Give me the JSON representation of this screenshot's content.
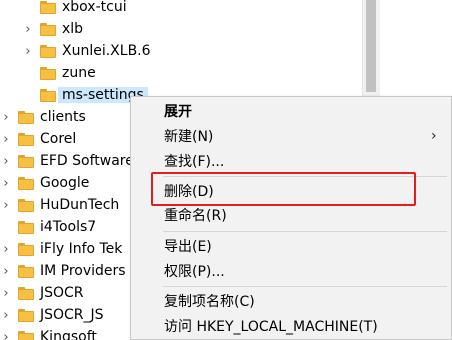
{
  "tree": {
    "child_folders": [
      {
        "label": "xbox-tcui",
        "expander": "",
        "selected": false
      },
      {
        "label": "xlb",
        "expander": "›",
        "selected": false
      },
      {
        "label": "Xunlei.XLB.6",
        "expander": "›",
        "selected": false
      },
      {
        "label": "zune",
        "expander": "",
        "selected": false
      },
      {
        "label": "ms-settings",
        "expander": "",
        "selected": true
      }
    ],
    "top_folders": [
      {
        "label": "clients",
        "expander": "›"
      },
      {
        "label": "Corel",
        "expander": "›"
      },
      {
        "label": "EFD Software",
        "expander": "›"
      },
      {
        "label": "Google",
        "expander": "›"
      },
      {
        "label": "HuDunTech",
        "expander": "›"
      },
      {
        "label": "i4Tools7",
        "expander": ""
      },
      {
        "label": "iFly Info Tek",
        "expander": "›"
      },
      {
        "label": "IM Providers",
        "expander": "›"
      },
      {
        "label": "JSOCR",
        "expander": "›"
      },
      {
        "label": "JSOCR_JS",
        "expander": "›"
      },
      {
        "label": "Kingsoft",
        "expander": "›"
      }
    ]
  },
  "context_menu": {
    "expand": "展开",
    "new": "新建(N)",
    "new_arrow": "›",
    "find": "查找(F)...",
    "delete": "删除(D)",
    "rename": "重命名(R)",
    "export": "导出(E)",
    "permissions": "权限(P)...",
    "copy_key_name": "复制项名称(C)",
    "visit_hklm": "访问 HKEY_LOCAL_MACHINE(T)"
  },
  "colors": {
    "selection": "#cce8ff",
    "menu_background": "#f2f2f2",
    "highlight_border": "#e02020",
    "folder": "#f6c142"
  },
  "icons": {
    "folder": "folder-icon",
    "expand": "chevron-right-icon"
  }
}
